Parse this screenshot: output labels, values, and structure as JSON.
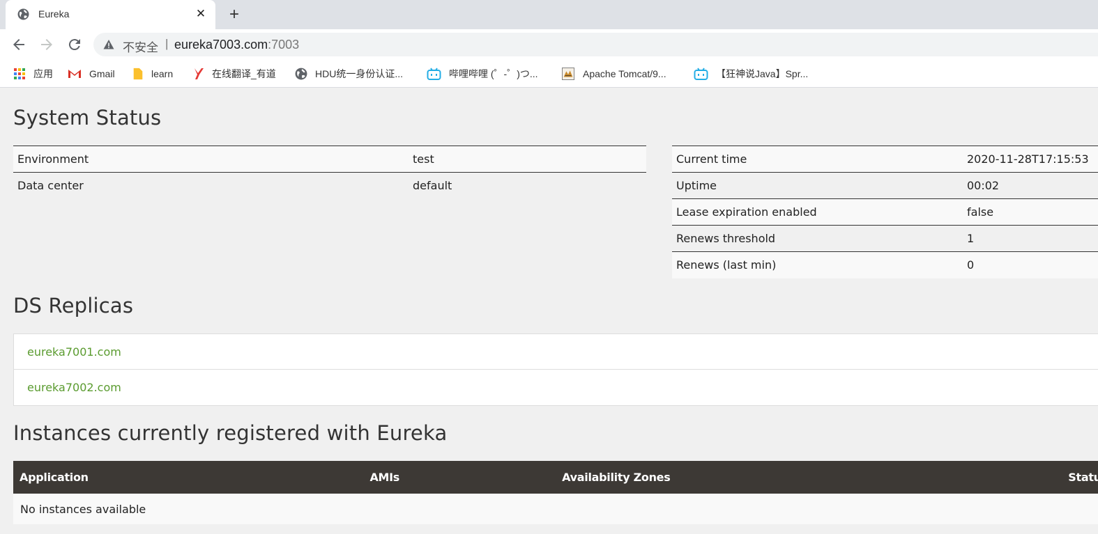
{
  "browser": {
    "tab_title": "Eureka",
    "new_tab_symbol": "+",
    "close_symbol": "✕",
    "insecure_label": "不安全",
    "separator": "|",
    "url_host": "eureka7003.com",
    "url_port": ":7003",
    "bookmarks": [
      {
        "label": "应用",
        "icon": "apps-grid-icon"
      },
      {
        "label": "Gmail",
        "icon": "gmail-icon"
      },
      {
        "label": "learn",
        "icon": "folder-icon"
      },
      {
        "label": "在线翻译_有道",
        "icon": "youdao-icon"
      },
      {
        "label": "HDU统一身份认证...",
        "icon": "globe-icon"
      },
      {
        "label": "哔哩哔哩 (゜-゜)つ...",
        "icon": "bilibili-icon"
      },
      {
        "label": "Apache Tomcat/9...",
        "icon": "tomcat-icon"
      },
      {
        "label": "【狂神说Java】Spr...",
        "icon": "bilibili-icon"
      }
    ]
  },
  "system_status": {
    "heading": "System Status",
    "left_rows": [
      {
        "label": "Environment",
        "value": "test"
      },
      {
        "label": "Data center",
        "value": "default"
      }
    ],
    "right_rows": [
      {
        "label": "Current time",
        "value": "2020-11-28T17:15:53"
      },
      {
        "label": "Uptime",
        "value": "00:02"
      },
      {
        "label": "Lease expiration enabled",
        "value": "false"
      },
      {
        "label": "Renews threshold",
        "value": "1"
      },
      {
        "label": "Renews (last min)",
        "value": "0"
      }
    ]
  },
  "ds_replicas": {
    "heading": "DS Replicas",
    "items": [
      "eureka7001.com",
      "eureka7002.com"
    ]
  },
  "instances": {
    "heading": "Instances currently registered with Eureka",
    "columns": [
      "Application",
      "AMIs",
      "Availability Zones",
      "Status"
    ],
    "empty_message": "No instances available"
  },
  "colors": {
    "link_green": "#5a9b2f",
    "table_header_bg": "#3d3935",
    "page_bg": "#f0f0f0"
  }
}
